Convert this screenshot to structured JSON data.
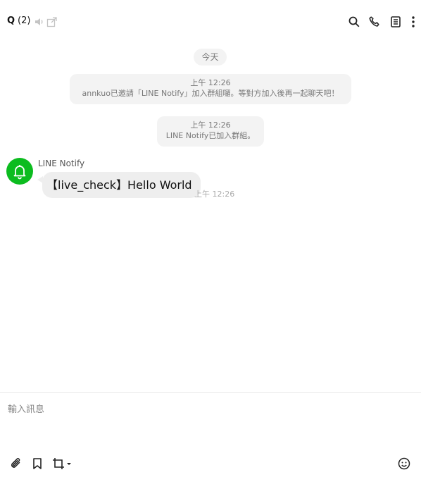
{
  "header": {
    "title": "Q",
    "member_count": "(2)",
    "icons": [
      "speaker-icon",
      "external-window-icon",
      "search-icon",
      "phone-icon",
      "notes-icon",
      "more-icon"
    ]
  },
  "chat": {
    "date_label": "今天",
    "system_messages": [
      {
        "time": "上午 12:26",
        "text": "annkuo已邀請「LINE Notify」加入群組囉。等對方加入後再一起聊天吧！"
      },
      {
        "time": "上午 12:26",
        "text": "LINE Notify已加入群組。"
      }
    ],
    "message": {
      "sender": "LINE Notify",
      "text": "【live_check】Hello World",
      "time": "上午 12:26",
      "avatar_color": "#0cbc1f",
      "avatar_icon": "bell-icon"
    }
  },
  "composer": {
    "placeholder": "輸入訊息",
    "tools": [
      "attach-icon",
      "bookmark-icon",
      "crop-icon",
      "emoji-icon"
    ]
  }
}
